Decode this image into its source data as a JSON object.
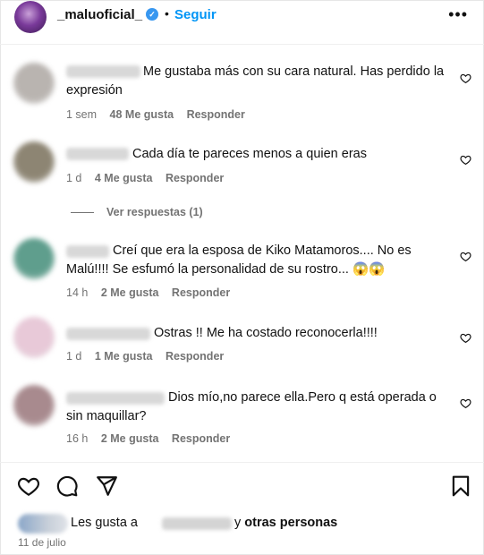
{
  "header": {
    "username": "_maluoficial_",
    "verified_icon": "verified-badge-icon",
    "separator": "•",
    "follow_label": "Seguir",
    "more_label": "•••"
  },
  "comments": [
    {
      "text": "Me gustaba más con su cara natural. Has perdido la expresión",
      "time": "1 sem",
      "likes": "48 Me gusta",
      "reply": "Responder",
      "avatar_color": "#b9b4b0"
    },
    {
      "text": "Cada día te pareces menos a quien eras",
      "time": "1 d",
      "likes": "4 Me gusta",
      "reply": "Responder",
      "avatar_color": "#8d8573"
    },
    {
      "text": "Creí que era la esposa de Kiko Matamoros.... No es Malú!!!! Se esfumó la personalidad de su rostro... 😱😱",
      "time": "14 h",
      "likes": "2 Me gusta",
      "reply": "Responder",
      "avatar_color": "#5f9e8d"
    },
    {
      "text": "Ostras !! Me ha costado reconocerla!!!!",
      "time": "1 d",
      "likes": "1 Me gusta",
      "reply": "Responder",
      "avatar_color": "#e8c9d8"
    },
    {
      "text": "Dios mío,no parece ella.Pero q está operada o sin maquillar?",
      "time": "16 h",
      "likes": "2 Me gusta",
      "reply": "Responder",
      "avatar_color": "#a88a8e"
    }
  ],
  "view_replies": "Ver respuestas (1)",
  "actions": {
    "like_icon": "heart-icon",
    "comment_icon": "comment-icon",
    "share_icon": "send-icon",
    "save_icon": "bookmark-icon"
  },
  "likes_summary": {
    "prefix": "Les gusta a",
    "connector": "y",
    "others": "otras personas"
  },
  "date": "11 de julio"
}
